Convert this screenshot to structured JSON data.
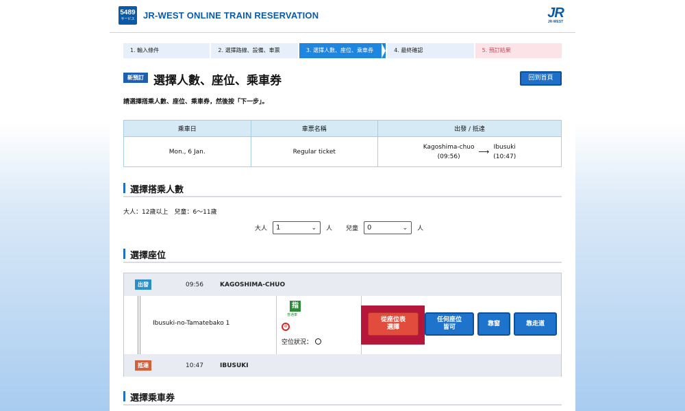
{
  "header": {
    "logo_number": "5489",
    "logo_sub": "サービス",
    "title": "JR-WEST ONLINE TRAIN RESERVATION",
    "brand_logo": "JR",
    "brand_sub": "JR-WEST"
  },
  "steps": [
    {
      "label": "1. 輸入條件",
      "state": "done"
    },
    {
      "label": "2. 選擇路線、設備、車票",
      "state": "done"
    },
    {
      "label": "3. 選擇人數、座位、乘車券",
      "state": "active"
    },
    {
      "label": "4. 最終確認",
      "state": "todo"
    },
    {
      "label": "5. 預訂結果",
      "state": "final"
    }
  ],
  "title_area": {
    "badge": "新預訂",
    "title": "選擇人數、座位、乘車券",
    "home_button": "回到首頁",
    "instruction": "請選擇搭乘人數、座位、乘車券，然後按「下一步」。"
  },
  "summary": {
    "headers": [
      "乘車日",
      "車票名稱",
      "出發 / 抵達"
    ],
    "date": "Mon., 6 Jan.",
    "ticket": "Regular ticket",
    "from_station": "Kagoshima-chuo",
    "from_time": "(09:56)",
    "to_station": "Ibusuki",
    "to_time": "(10:47)"
  },
  "passengers": {
    "heading": "選擇搭乘人數",
    "age_note": "大人：12歲以上　兒童：6〜11歲",
    "adult_label": "大人",
    "adult_value": "1",
    "child_label": "兒童",
    "child_value": "0",
    "unit": "人"
  },
  "seats": {
    "heading": "選擇座位",
    "departure": {
      "badge": "出發",
      "time": "09:56",
      "station": "KAGOSHIMA-CHUO",
      "color": "#2a8fc7"
    },
    "arrival": {
      "badge": "抵達",
      "time": "10:47",
      "station": "IBUSUKI",
      "color": "#d2603a"
    },
    "train_name": "Ibusuki-no-Tamatebako 1",
    "reserved_icon": "指",
    "car_type": "普通車",
    "vacancy_label": "空位狀況：",
    "buttons": {
      "seat_map": "從座位表\n選擇",
      "any_seat": "任何座位\n皆可",
      "window": "靠窗",
      "aisle": "靠走道"
    }
  },
  "tickets": {
    "heading": "選擇乘車券"
  }
}
